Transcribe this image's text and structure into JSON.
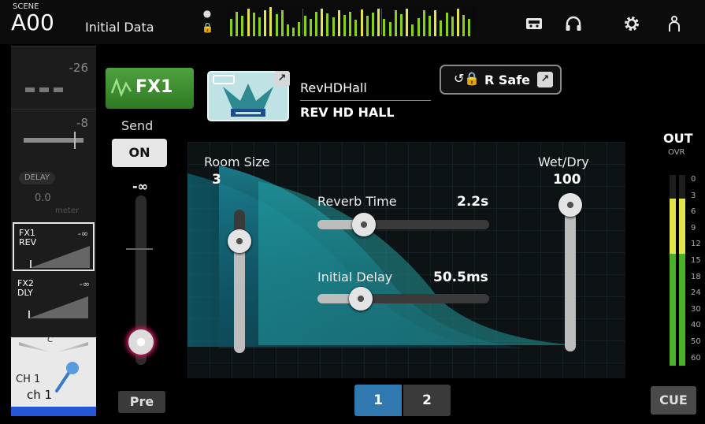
{
  "header": {
    "scene_caption": "SCENE",
    "scene_number": "A00",
    "scene_name": "Initial Data",
    "icons": [
      "recorder-icon",
      "headphones-icon",
      "gear-icon",
      "user-icon"
    ]
  },
  "left_strip": {
    "values": [
      "-26",
      "-8"
    ],
    "delay_label": "DELAY",
    "delay_value": "0.0",
    "meter_label": "meter",
    "fx1": {
      "name": "FX1",
      "type": "REV",
      "level": "-∞"
    },
    "fx2": {
      "name": "FX2",
      "type": "DLY",
      "level": "-∞"
    },
    "channel": {
      "pan_label": "C",
      "label": "CH 1",
      "name": "ch 1",
      "color": "#2456d6"
    }
  },
  "send": {
    "fx_button_label": "FX1",
    "label": "Send",
    "on_label": "ON",
    "value": "-∞",
    "pre_label": "Pre"
  },
  "effect": {
    "type_name": "RevHDHall",
    "type_desc": "REV HD HALL",
    "rsafe_label": "R Safe"
  },
  "params": {
    "room_size": {
      "label": "Room Size",
      "value": "3",
      "level": 0.78
    },
    "reverb_time": {
      "label": "Reverb Time",
      "value": "2.2s",
      "level": 0.27
    },
    "initial_delay": {
      "label": "Initial Delay",
      "value": "50.5ms",
      "level": 0.25
    },
    "wet_dry": {
      "label": "Wet/Dry",
      "value": "100",
      "level": 1.0
    }
  },
  "out_meter": {
    "label": "OUT",
    "ovr_label": "OVR",
    "scale": [
      "0",
      "3",
      "6",
      "9",
      "12",
      "15",
      "18",
      "24",
      "30",
      "40",
      "50",
      "60"
    ]
  },
  "pages": [
    {
      "label": "1",
      "active": true
    },
    {
      "label": "2",
      "active": false
    }
  ],
  "cue_label": "CUE",
  "colors": {
    "accent_green": "#3f8f2f",
    "active_page": "#2f78b0",
    "meter_green": "#4caf2a",
    "meter_yellow": "#e3e34a"
  }
}
